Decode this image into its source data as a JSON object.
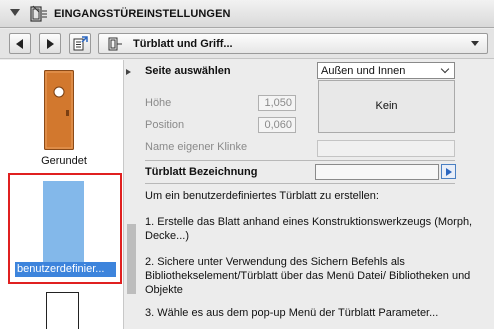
{
  "header": {
    "title": "EINGANGSTÜREINSTELLUNGEN"
  },
  "toolbar": {
    "selector_label": "Türblatt und Griff..."
  },
  "gallery": {
    "items": [
      {
        "label": "Gerundet"
      },
      {
        "label": "benutzerdefinier..."
      }
    ]
  },
  "form": {
    "side_label": "Seite auswählen",
    "side_value": "Außen und Innen",
    "height_label": "Höhe",
    "height_value": "1,050",
    "position_label": "Position",
    "position_value": "0,060",
    "handle_label": "Name eigener Klinke",
    "preview_label": "Kein",
    "name_label": "Türblatt Bezeichnung",
    "name_value": ""
  },
  "instructions": {
    "intro": "Um ein benutzerdefiniertes Türblatt zu erstellen:",
    "step1": "1. Erstelle das Blatt anhand eines Konstruktionswerkzeugs (Morph, Decke...)",
    "step2": "2. Sichere unter Verwendung des Sichern Befehls als Bibliothekselement/Türblatt über das Menü Datei/ Bibliotheken und Objekte",
    "step3": "3. Wähle es aus dem pop-up Menü der Türblatt Parameter..."
  },
  "colors": {
    "selection_border": "#e02020",
    "selection_fill": "#83b8ea",
    "selection_label_bg": "#3d84dc",
    "door": "#d2782e"
  }
}
